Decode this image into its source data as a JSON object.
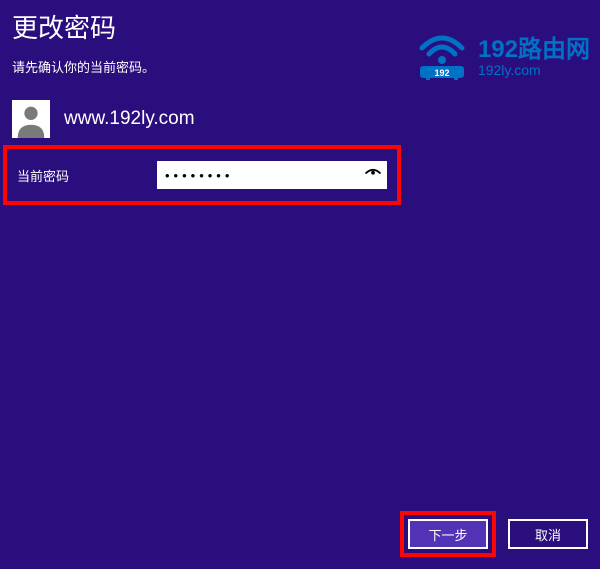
{
  "header": {
    "title": "更改密码",
    "subtitle": "请先确认你的当前密码。"
  },
  "user": {
    "name": "www.192ly.com"
  },
  "form": {
    "current_password_label": "当前密码",
    "current_password_value": "••••••••"
  },
  "watermark": {
    "main": "192路由网",
    "sub": "192ly.com",
    "badge": "192"
  },
  "buttons": {
    "next": "下一步",
    "cancel": "取消"
  }
}
